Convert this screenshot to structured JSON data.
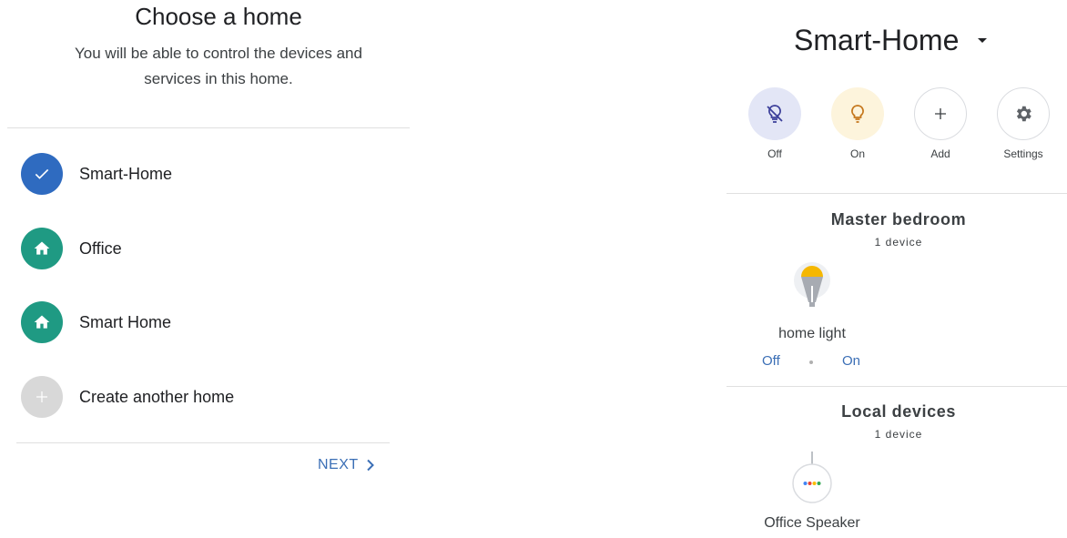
{
  "left": {
    "title": "Choose a home",
    "subtitle_line1": "You will be able to control the devices and",
    "subtitle_line2": "services in this home.",
    "homes": [
      {
        "label": "Smart-Home",
        "icon": "check-icon",
        "selected": true
      },
      {
        "label": "Office",
        "icon": "home-icon",
        "selected": false
      },
      {
        "label": "Smart Home",
        "icon": "home-icon",
        "selected": false
      },
      {
        "label": "Create another home",
        "icon": "plus-icon",
        "selected": false
      }
    ],
    "next_label": "NEXT"
  },
  "right": {
    "home_name": "Smart-Home",
    "actions": [
      {
        "label": "Off",
        "icon": "light-off-icon"
      },
      {
        "label": "On",
        "icon": "lightbulb-icon"
      },
      {
        "label": "Add",
        "icon": "plus-icon"
      },
      {
        "label": "Settings",
        "icon": "gear-icon"
      }
    ],
    "rooms": [
      {
        "name": "Master bedroom",
        "count": "1 device",
        "device": {
          "label": "home light",
          "icon": "light-bulb-icon"
        },
        "off_label": "Off",
        "on_label": "On"
      },
      {
        "name": "Local devices",
        "count": "1 device",
        "device": {
          "label": "Office Speaker",
          "icon": "speaker-icon"
        }
      }
    ]
  },
  "colors": {
    "selected_blue": "#2f6bc0",
    "home_teal": "#1f9a83",
    "link_blue": "#3b6fb6",
    "light_yellow": "#f5b700"
  }
}
